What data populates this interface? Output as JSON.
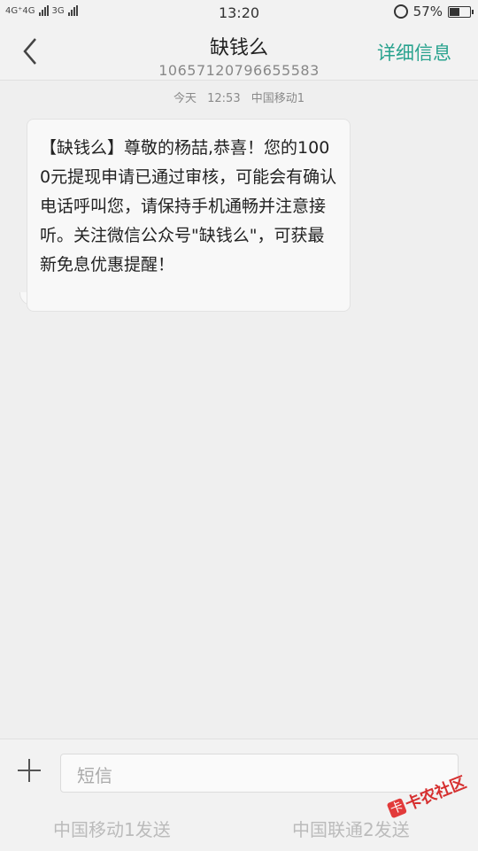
{
  "status_bar": {
    "sim1_label": "4G⁺4G",
    "sim2_label": "3G",
    "time": "13:20",
    "battery_percent": "57%",
    "battery_level": 0.57
  },
  "header": {
    "title": "缺钱么",
    "number": "10657120796655583",
    "details_label": "详细信息"
  },
  "message": {
    "day": "今天",
    "time": "12:53",
    "carrier": "中国移动1",
    "text": "【缺钱么】尊敬的杨喆,恭喜！您的1000元提现申请已通过审核，可能会有确认电话呼叫您，请保持手机通畅并注意接听。关注微信公众号\"缺钱么\"，可获最新免息优惠提醒！"
  },
  "compose": {
    "placeholder": "短信",
    "send_sim1": "中国移动1发送",
    "send_sim2": "中国联通2发送"
  },
  "watermark": {
    "text": "卡农社区"
  }
}
